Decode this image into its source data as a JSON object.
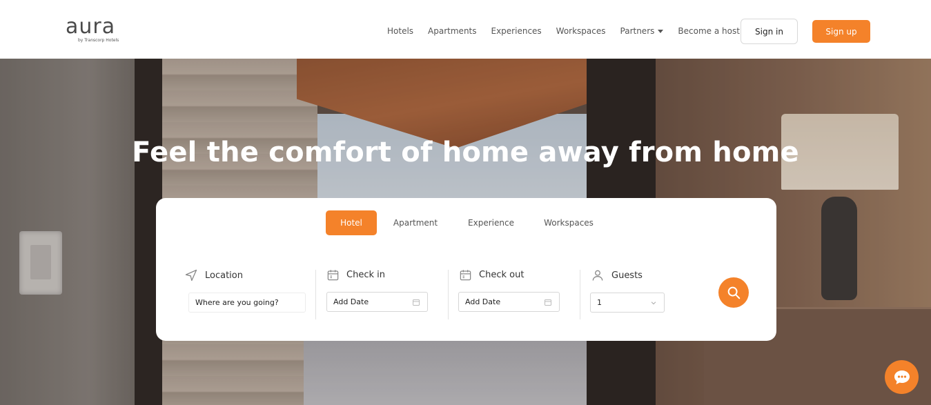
{
  "brand": {
    "logo_text": "aura",
    "logo_subtext": "by Transcorp Hotels",
    "accent_color": "#f4822a"
  },
  "nav": {
    "items": [
      {
        "label": "Hotels"
      },
      {
        "label": "Apartments"
      },
      {
        "label": "Experiences"
      },
      {
        "label": "Workspaces"
      },
      {
        "label": "Partners",
        "has_dropdown": true
      },
      {
        "label": "Become a host"
      }
    ],
    "signin_label": "Sign in",
    "signup_label": "Sign up"
  },
  "hero": {
    "title": "Feel the comfort of home away from home"
  },
  "search": {
    "tabs": [
      {
        "label": "Hotel",
        "active": true
      },
      {
        "label": "Apartment",
        "active": false
      },
      {
        "label": "Experience",
        "active": false
      },
      {
        "label": "Workspaces",
        "active": false
      }
    ],
    "location": {
      "label": "Location",
      "placeholder": "Where are you going?",
      "icon": "navigation-arrow-icon"
    },
    "checkin": {
      "label": "Check in",
      "value": "Add Date",
      "icon": "calendar-icon"
    },
    "checkout": {
      "label": "Check out",
      "value": "Add Date",
      "icon": "calendar-icon"
    },
    "guests": {
      "label": "Guests",
      "value": "1",
      "icon": "user-icon"
    },
    "search_icon": "search-icon"
  },
  "chat": {
    "icon": "chat-bubble-icon"
  }
}
